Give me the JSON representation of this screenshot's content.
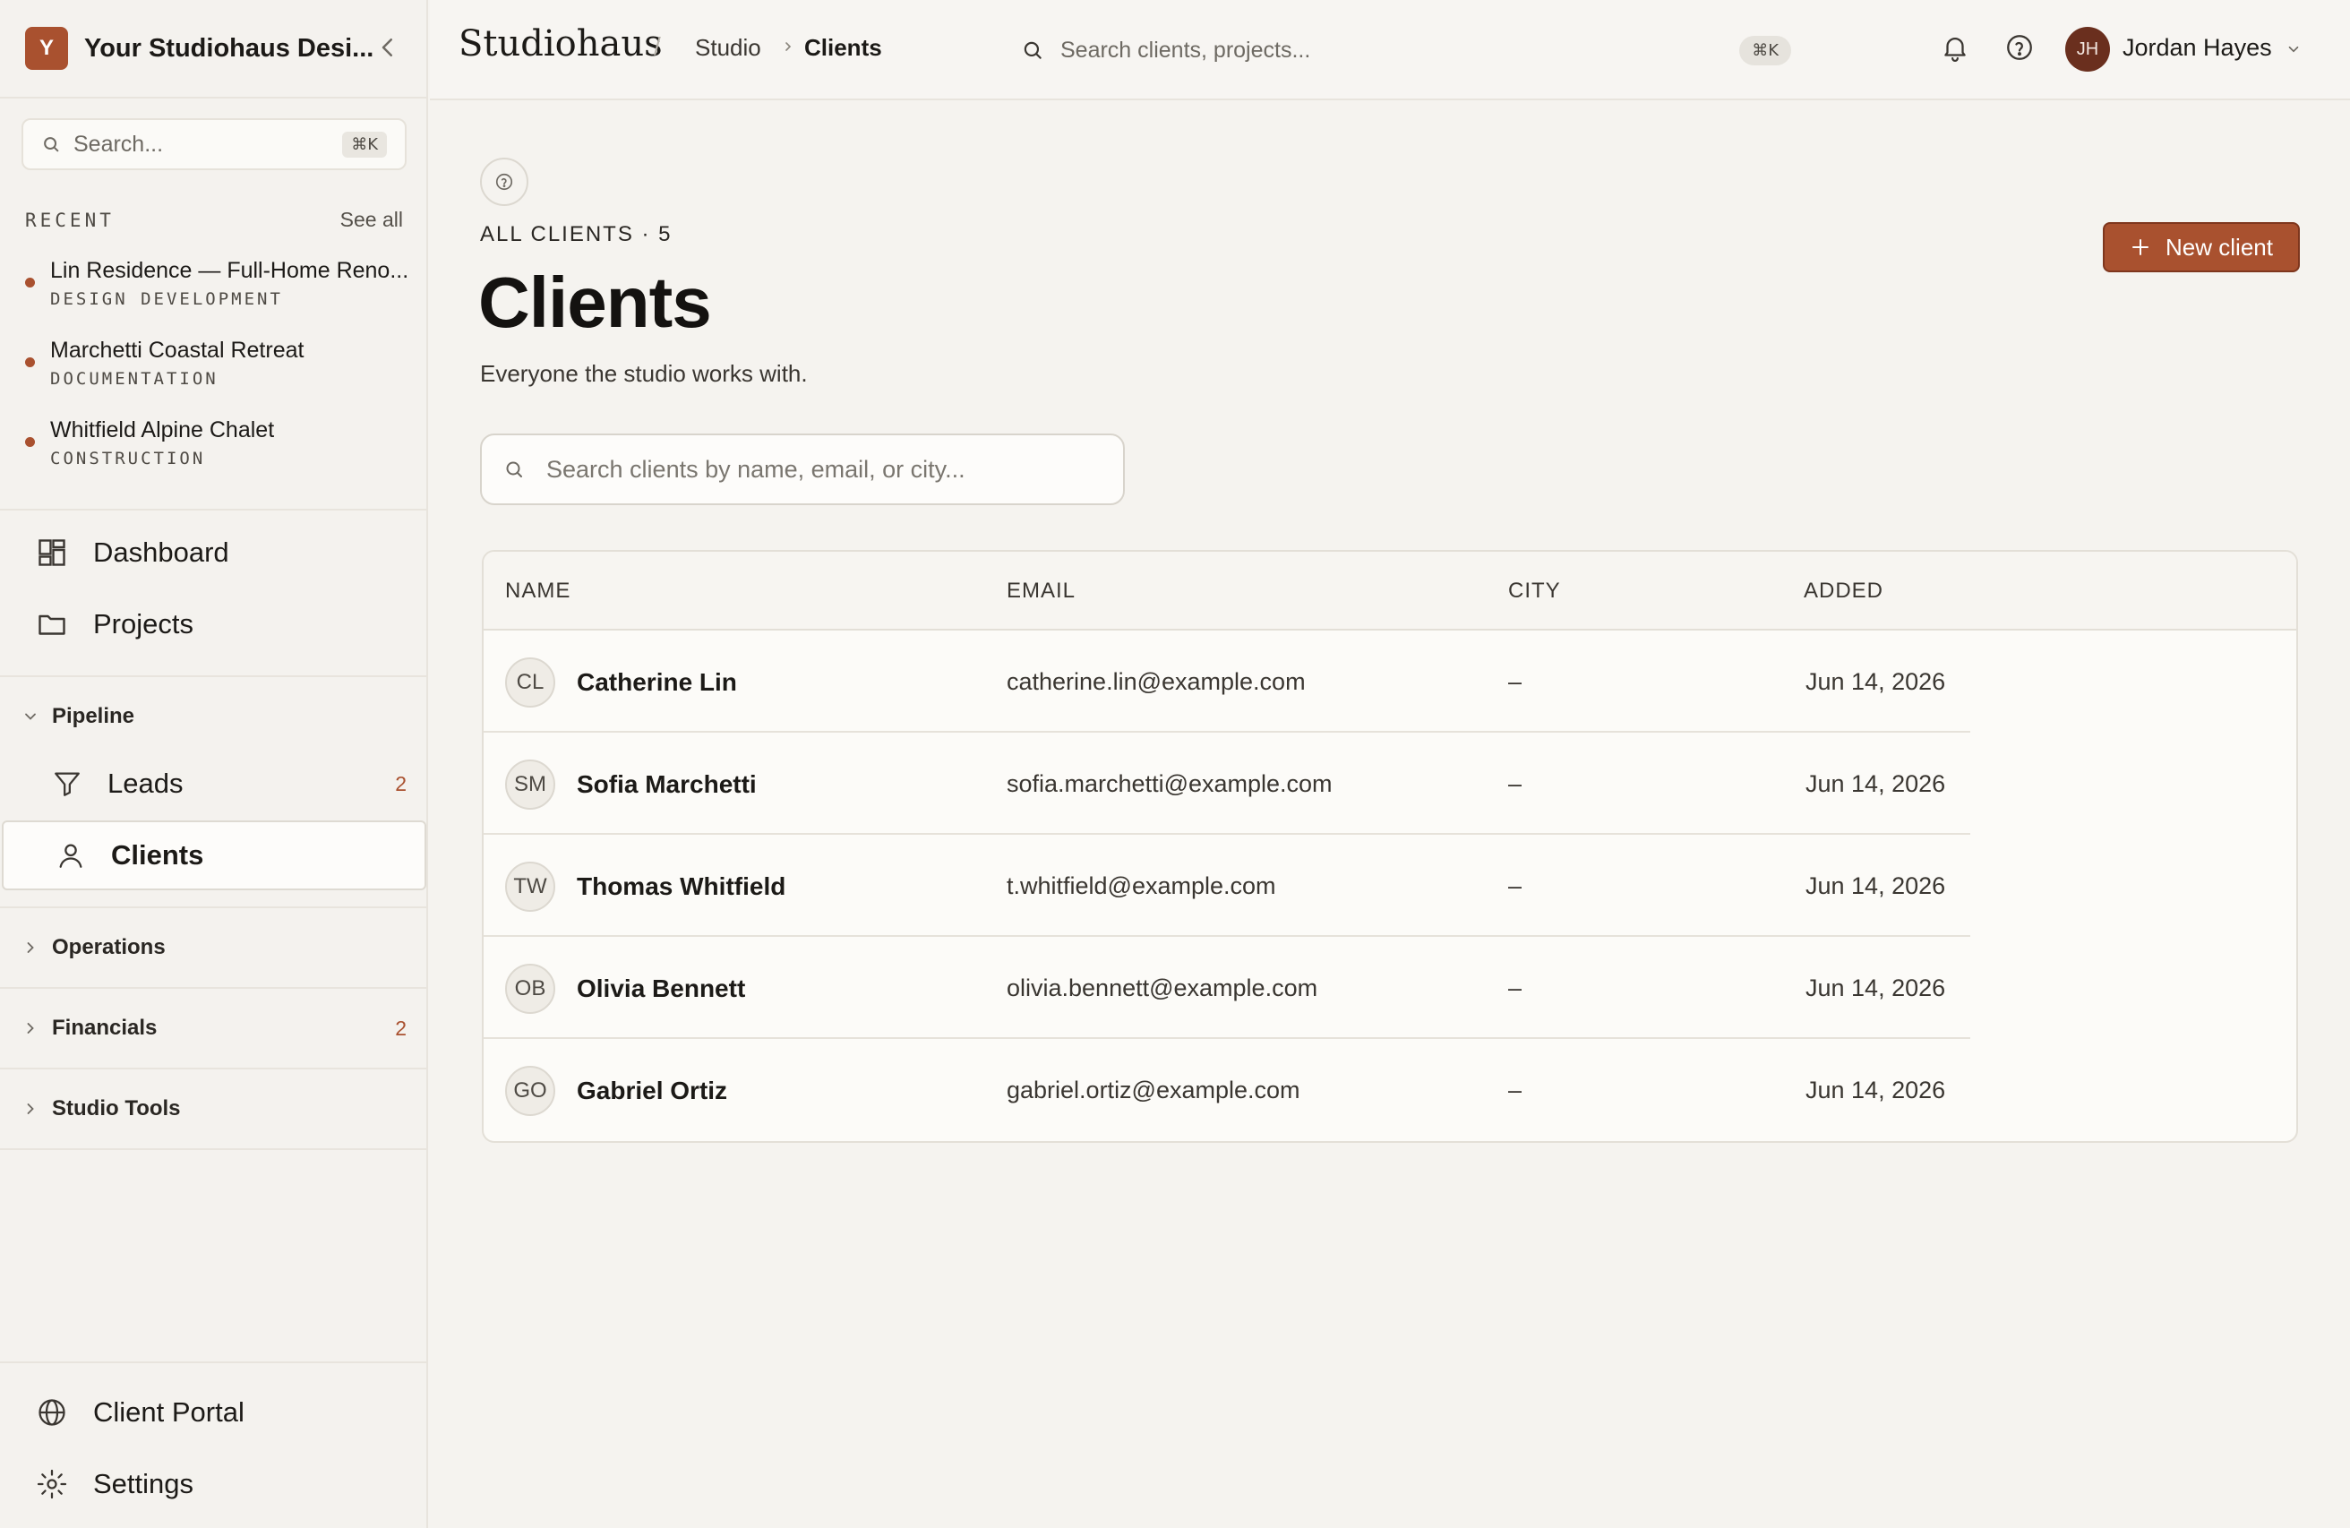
{
  "sidebar": {
    "workspace_initial": "Y",
    "workspace_name": "Your Studiohaus Desi...",
    "search_placeholder": "Search...",
    "search_shortcut": "⌘K",
    "recent_title": "RECENT",
    "see_all": "See all",
    "recent": [
      {
        "name": "Lin Residence — Full-Home Reno...",
        "stage": "DESIGN DEVELOPMENT"
      },
      {
        "name": "Marchetti Coastal Retreat",
        "stage": "DOCUMENTATION"
      },
      {
        "name": "Whitfield Alpine Chalet",
        "stage": "CONSTRUCTION"
      }
    ],
    "nav": [
      {
        "label": "Dashboard",
        "icon": "grid-icon"
      },
      {
        "label": "Projects",
        "icon": "folder-icon"
      }
    ],
    "pipeline": {
      "label": "Pipeline",
      "items": [
        {
          "label": "Leads",
          "icon": "filter-icon",
          "badge": "2"
        },
        {
          "label": "Clients",
          "icon": "user-icon",
          "badge": ""
        }
      ]
    },
    "groups": [
      {
        "label": "Operations",
        "badge": ""
      },
      {
        "label": "Financials",
        "badge": "2"
      },
      {
        "label": "Studio Tools",
        "badge": ""
      }
    ],
    "footer": [
      {
        "label": "Client Portal",
        "icon": "globe-icon"
      },
      {
        "label": "Settings",
        "icon": "gear-icon"
      }
    ]
  },
  "topbar": {
    "brand": "Studiohaus",
    "crumb_sep": "/",
    "breadcrumb": [
      "Studio",
      "Clients"
    ],
    "search_placeholder": "Search clients, projects...",
    "search_shortcut": "⌘K",
    "user_initials": "JH",
    "user_name": "Jordan Hayes"
  },
  "main": {
    "eyebrow": "ALL CLIENTS · 5",
    "title": "Clients",
    "subtitle": "Everyone the studio works with.",
    "new_button": "New client",
    "search_placeholder": "Search clients by name, email, or city...",
    "columns": [
      "NAME",
      "EMAIL",
      "CITY",
      "ADDED"
    ],
    "rows": [
      {
        "initials": "CL",
        "name": "Catherine Lin",
        "email": "catherine.lin@example.com",
        "city": "–",
        "added": "Jun 14, 2026"
      },
      {
        "initials": "SM",
        "name": "Sofia Marchetti",
        "email": "sofia.marchetti@example.com",
        "city": "–",
        "added": "Jun 14, 2026"
      },
      {
        "initials": "TW",
        "name": "Thomas Whitfield",
        "email": "t.whitfield@example.com",
        "city": "–",
        "added": "Jun 14, 2026"
      },
      {
        "initials": "OB",
        "name": "Olivia Bennett",
        "email": "olivia.bennett@example.com",
        "city": "–",
        "added": "Jun 14, 2026"
      },
      {
        "initials": "GO",
        "name": "Gabriel Ortiz",
        "email": "gabriel.ortiz@example.com",
        "city": "–",
        "added": "Jun 14, 2026"
      }
    ]
  },
  "colors": {
    "accent": "#a9512f",
    "avatar": "#6a2f1e",
    "background": "#f5f3ef"
  }
}
